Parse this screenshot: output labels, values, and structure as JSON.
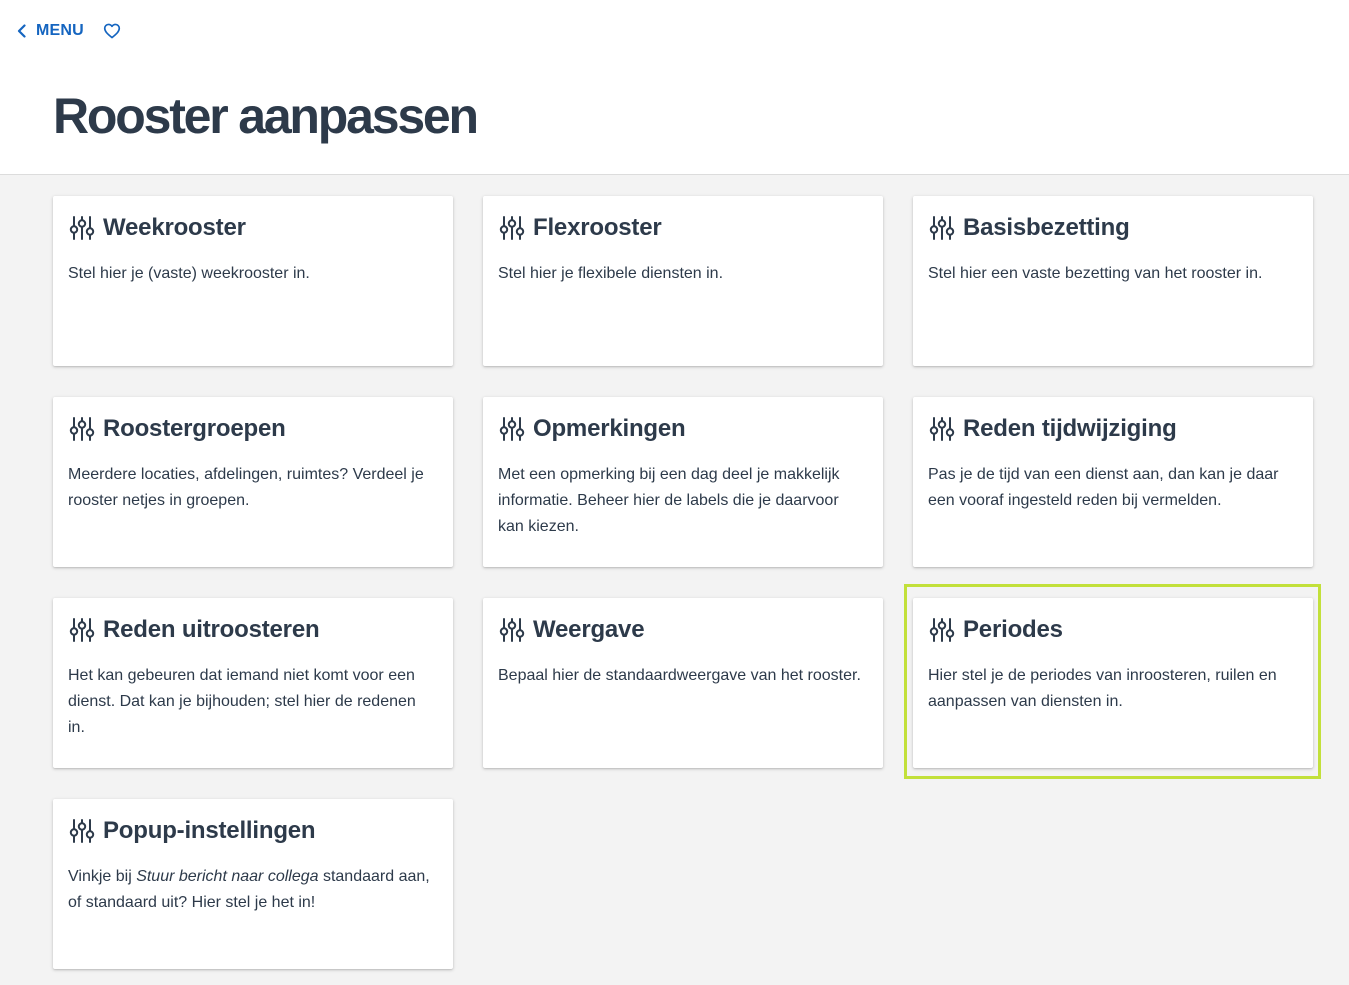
{
  "nav": {
    "back_label": "MENU",
    "back_icon": "chevron-left-icon",
    "favorite_icon": "heart-outline-icon"
  },
  "page": {
    "title": "Rooster aanpassen"
  },
  "colors": {
    "accent": "#1565c0",
    "text": "#2d3a4a",
    "highlight": "#c2e03a",
    "background": "#f3f3f3"
  },
  "cards": [
    {
      "title": "Weekrooster",
      "icon": "sliders-icon",
      "desc": "Stel hier je (vaste) weekrooster in."
    },
    {
      "title": "Flexrooster",
      "icon": "sliders-icon",
      "desc": "Stel hier je flexibele diensten in."
    },
    {
      "title": "Basisbezetting",
      "icon": "sliders-icon",
      "desc": "Stel hier een vaste bezetting van het rooster in."
    },
    {
      "title": "Roostergroepen",
      "icon": "sliders-icon",
      "desc": "Meerdere locaties, afdelingen, ruimtes? Verdeel je rooster netjes in groepen."
    },
    {
      "title": "Opmerkingen",
      "icon": "sliders-icon",
      "desc": "Met een opmerking bij een dag deel je makkelijk informatie. Beheer hier de labels die je daarvoor kan kiezen."
    },
    {
      "title": "Reden tijdwijziging",
      "icon": "sliders-icon",
      "desc": "Pas je de tijd van een dienst aan, dan kan je daar een vooraf ingesteld reden bij vermelden."
    },
    {
      "title": "Reden uitroosteren",
      "icon": "sliders-icon",
      "desc": "Het kan gebeuren dat iemand niet komt voor een dienst. Dat kan je bijhouden; stel hier de redenen in."
    },
    {
      "title": "Weergave",
      "icon": "sliders-icon",
      "desc": "Bepaal hier de standaardweergave van het rooster."
    },
    {
      "title": "Periodes",
      "icon": "sliders-icon",
      "desc": "Hier stel je de periodes van inroosteren, ruilen en aanpassen van diensten in."
    },
    {
      "title": "Popup-instellingen",
      "icon": "sliders-icon",
      "desc_before": "Vinkje bij ",
      "desc_em": "Stuur bericht naar collega",
      "desc_after": " standaard aan, of standaard uit? Hier stel je het in!"
    }
  ]
}
